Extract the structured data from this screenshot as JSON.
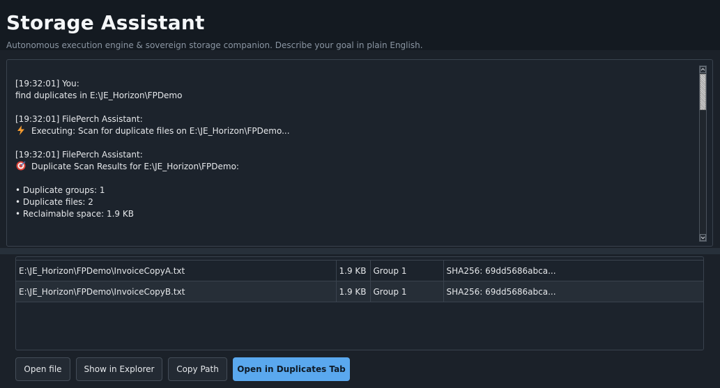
{
  "header": {
    "title": "Storage Assistant",
    "subtitle": "Autonomous execution engine & sovereign storage companion. Describe your goal in plain English."
  },
  "chat": {
    "messages": [
      {
        "header": "[19:32:01] You:",
        "lines": [
          "find duplicates in E:\\JE_Horizon\\FPDemo"
        ]
      },
      {
        "header": "[19:32:01] FilePerch Assistant:",
        "icon": "lightning-bolt-icon",
        "lines": [
          "Executing: Scan for duplicate files on E:\\JE_Horizon\\FPDemo..."
        ]
      },
      {
        "header": "[19:32:01] FilePerch Assistant:",
        "icon": "target-icon",
        "lines": [
          "Duplicate Scan Results for E:\\JE_Horizon\\FPDemo:"
        ]
      }
    ],
    "bullets": [
      "• Duplicate groups: 1",
      "• Duplicate files: 2",
      "• Reclaimable space: 1.9 KB"
    ]
  },
  "results": {
    "rows": [
      {
        "path": "E:\\JE_Horizon\\FPDemo\\InvoiceCopyA.txt",
        "size": "1.9 KB",
        "group": "Group 1",
        "hash": "SHA256: 69dd5686abca..."
      },
      {
        "path": "E:\\JE_Horizon\\FPDemo\\InvoiceCopyB.txt",
        "size": "1.9 KB",
        "group": "Group 1",
        "hash": "SHA256: 69dd5686abca..."
      }
    ]
  },
  "actions": {
    "open_file": "Open file",
    "show_in_explorer": "Show in Explorer",
    "copy_path": "Copy Path",
    "open_in_duplicates_tab": "Open in Duplicates Tab"
  },
  "colors": {
    "background": "#1b2129",
    "header_background": "#141a21",
    "accent": "#5aa8ee",
    "bolt_icon": "#f59b2e",
    "target_icon": "#e0433a"
  }
}
